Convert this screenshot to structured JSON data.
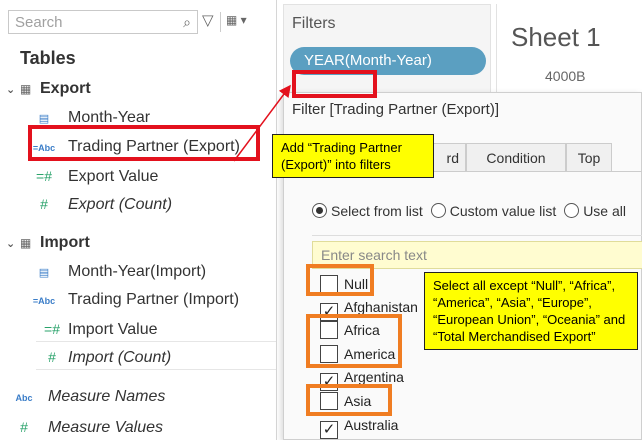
{
  "left_pane": {
    "search_placeholder": "Search",
    "tables_title": "Tables",
    "export_group": {
      "name": "Export",
      "fields": [
        {
          "type": "date",
          "label": "Month-Year"
        },
        {
          "type": "abc",
          "label": "Trading Partner (Export)"
        },
        {
          "type": "measure",
          "label": "Export Value"
        },
        {
          "type": "measure",
          "label": "Export (Count)"
        }
      ]
    },
    "import_group": {
      "name": "Import",
      "fields": [
        {
          "type": "date",
          "label": "Month-Year(Import)"
        },
        {
          "type": "abc",
          "label": "Trading Partner (Import)"
        },
        {
          "type": "measure",
          "label": "Import Value"
        },
        {
          "type": "measure",
          "label": "Import (Count)"
        }
      ]
    },
    "extra_fields": [
      {
        "type": "abc",
        "label": "Measure Names"
      },
      {
        "type": "measure",
        "label": "Measure Values"
      }
    ]
  },
  "filters_card": {
    "title": "Filters",
    "pill": "YEAR(Month-Year)"
  },
  "sheet": {
    "title": "Sheet 1",
    "axis_label": "4000B"
  },
  "dialog": {
    "title": "Filter [Trading Partner (Export)]",
    "tabs": [
      "rd",
      "Condition",
      "Top"
    ],
    "radio_options": [
      "Select from list",
      "Custom value list",
      "Use all"
    ],
    "search_placeholder": "Enter search text",
    "items": [
      {
        "label": "Null",
        "checked": false
      },
      {
        "label": "Afghanistan",
        "checked": true
      },
      {
        "label": "Africa",
        "checked": false
      },
      {
        "label": "America",
        "checked": false
      },
      {
        "label": "Argentina",
        "checked": true
      },
      {
        "label": "Asia",
        "checked": false
      },
      {
        "label": "Australia",
        "checked": true
      }
    ]
  },
  "annotations": {
    "note1": "Add “Trading Partner (Export)” into filters",
    "note2": "Select all except “Null”, “Africa”, “America”, “Asia”, “Europe”, “European Union”, “Oceania” and “Total Merchandised Export”"
  },
  "colors": {
    "highlight_red": "#e3111d",
    "highlight_orange": "#f07d22",
    "note_bg": "#ffff00",
    "pill_bg": "#5b9fc1"
  }
}
